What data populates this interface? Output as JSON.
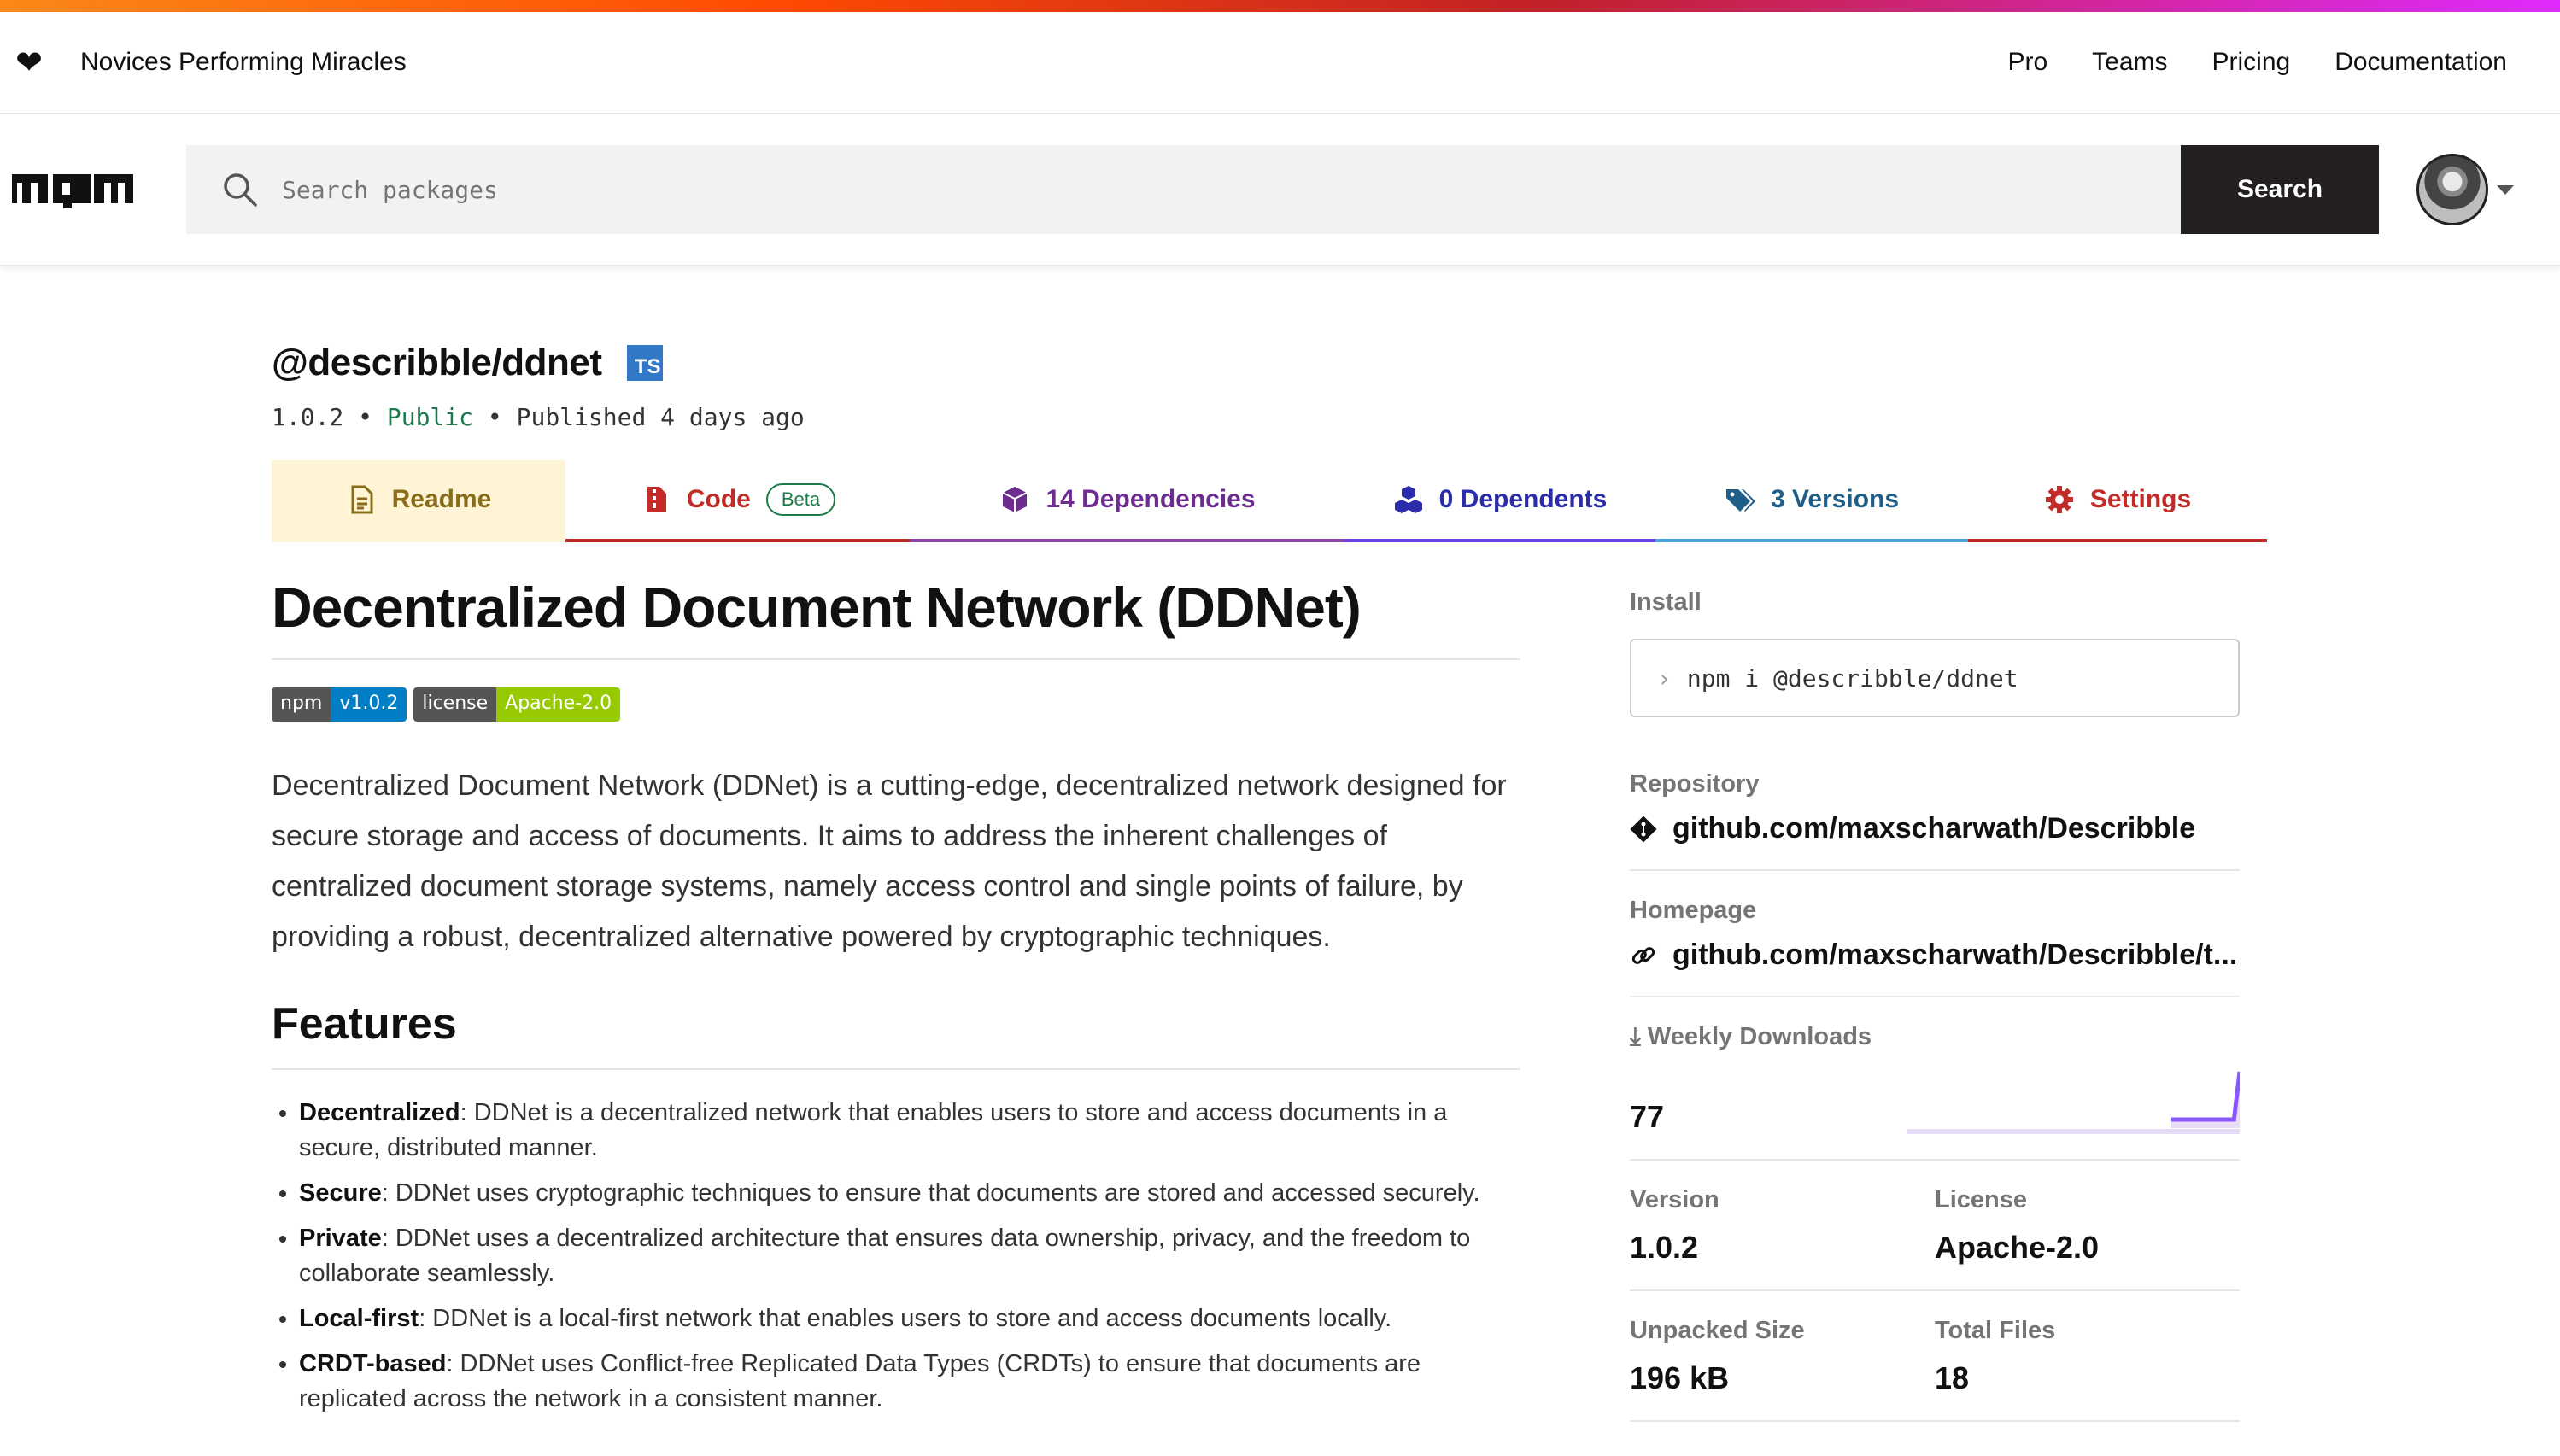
{
  "header": {
    "tagline": "Novices Performing Miracles",
    "nav": [
      "Pro",
      "Teams",
      "Pricing",
      "Documentation"
    ]
  },
  "search": {
    "placeholder": "Search packages",
    "button_label": "Search"
  },
  "package": {
    "name": "@describble/ddnet",
    "ts_badge": "TS",
    "version": "1.0.2",
    "visibility": "Public",
    "published": "Published 4 days ago"
  },
  "tabs": {
    "readme": "Readme",
    "code": "Code",
    "beta": "Beta",
    "dependencies": "14 Dependencies",
    "dependents": "0 Dependents",
    "versions": "3 Versions",
    "settings": "Settings"
  },
  "readme": {
    "title": "Decentralized Document Network (DDNet)",
    "badges": [
      {
        "label": "npm",
        "value": "v1.0.2",
        "color": "#007ec6"
      },
      {
        "label": "license",
        "value": "Apache-2.0",
        "color": "#97ca00"
      }
    ],
    "intro": "Decentralized Document Network (DDNet) is a cutting-edge, decentralized network designed for secure storage and access of documents. It aims to address the inherent challenges of centralized document storage systems, namely access control and single points of failure, by providing a robust, decentralized alternative powered by cryptographic techniques.",
    "features_heading": "Features",
    "features": [
      {
        "name": "Decentralized",
        "text": ": DDNet is a decentralized network that enables users to store and access documents in a secure, distributed manner."
      },
      {
        "name": "Secure",
        "text": ": DDNet uses cryptographic techniques to ensure that documents are stored and accessed securely."
      },
      {
        "name": "Private",
        "text": ": DDNet uses a decentralized architecture that ensures data ownership, privacy, and the freedom to collaborate seamlessly."
      },
      {
        "name": "Local-first",
        "text": ": DDNet is a local-first network that enables users to store and access documents locally."
      },
      {
        "name": "CRDT-based",
        "text": ": DDNet uses Conflict-free Replicated Data Types (CRDTs) to ensure that documents are replicated across the network in a consistent manner."
      }
    ]
  },
  "sidebar": {
    "install_label": "Install",
    "install_prompt": "›",
    "install_cmd": "npm i @describble/ddnet",
    "repository_label": "Repository",
    "repository": "github.com/maxscharwath/Describble",
    "homepage_label": "Homepage",
    "homepage": "github.com/maxscharwath/Describble/t...",
    "downloads_label": "Weekly Downloads",
    "downloads": "77",
    "downloads_trend": [
      0,
      0,
      0,
      0,
      0,
      0,
      0,
      0,
      0,
      0,
      0,
      0,
      1
    ],
    "version_label": "Version",
    "version": "1.0.2",
    "license_label": "License",
    "license": "Apache-2.0",
    "unpacked_label": "Unpacked Size",
    "unpacked": "196 kB",
    "files_label": "Total Files",
    "files": "18"
  }
}
